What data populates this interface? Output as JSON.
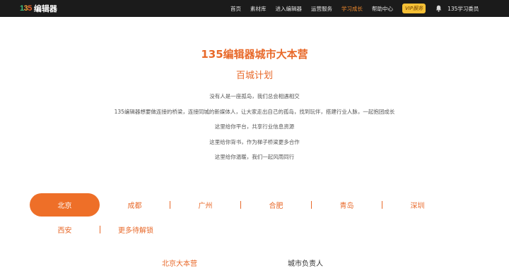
{
  "header": {
    "logo_mark": [
      "1",
      "3",
      "5"
    ],
    "logo_text": "编辑器",
    "nav": [
      {
        "label": "首页",
        "active": false
      },
      {
        "label": "素材库",
        "active": false
      },
      {
        "label": "进入编辑器",
        "active": false
      },
      {
        "label": "运营服务",
        "active": false
      },
      {
        "label": "学习成长",
        "active": true
      },
      {
        "label": "帮助中心",
        "active": false
      }
    ],
    "vip_label": "VIP服务",
    "bell_icon": "bell-icon",
    "user_label": "135学习委员"
  },
  "hero": {
    "title": "135编辑器城市大本营",
    "subtitle": "百城计划",
    "lines": [
      "没有人是一座孤岛，我们总会相遇相交",
      "135编辑器想要做连接的桥梁，连接同城的新媒体人，让大家走出自己的孤岛，找到玩伴，搭建行业人脉，一起抱团成长",
      "这里给你平台，共享行业信息资源",
      "这里给你背书，作为梯子桥梁更多合作",
      "这里给你温暖，我们一起风雨同行"
    ]
  },
  "cities": {
    "row1": [
      {
        "label": "北京",
        "active": true
      },
      {
        "label": "成都",
        "active": false
      },
      {
        "label": "广州",
        "active": false
      },
      {
        "label": "合肥",
        "active": false
      },
      {
        "label": "青岛",
        "active": false
      },
      {
        "label": "深圳",
        "active": false
      }
    ],
    "row2": [
      {
        "label": "西安",
        "active": false
      },
      {
        "label": "更多待解锁",
        "active": false
      }
    ]
  },
  "sections": {
    "left": "北京大本营",
    "right": "城市负责人"
  },
  "colors": {
    "accent": "#e8692a",
    "tab_active_bg": "#ee6f28",
    "topbar_bg": "#1b1b1b",
    "vip_bg": "#f5c036"
  }
}
